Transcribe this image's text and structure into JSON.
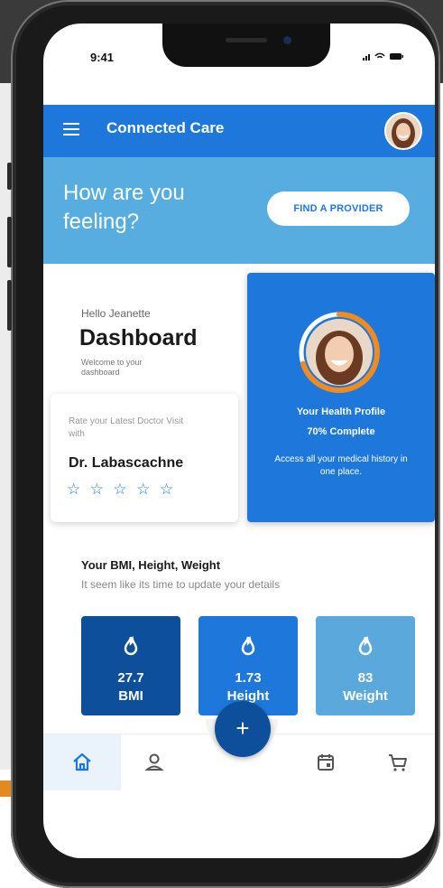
{
  "status_bar": {
    "time": "9:41",
    "icons": "▮▮▮ ◔ ▬"
  },
  "app_bar": {
    "title": "Connected Care"
  },
  "feeling": {
    "heading": "How are you feeling?",
    "button": "FIND A PROVIDER"
  },
  "dashboard": {
    "greeting": "Hello Jeanette",
    "title": "Dashboard",
    "welcome": "Welcome to your dashboard"
  },
  "rate": {
    "prompt": "Rate your Latest Doctor Visit with",
    "doctor": "Dr. Labascachne",
    "stars": [
      "☆",
      "☆",
      "☆",
      "☆",
      "☆"
    ]
  },
  "profile": {
    "title": "Your Health Profile",
    "complete": "70% Complete",
    "progress": 0.7,
    "description": "Access all your medical history in one place."
  },
  "metrics": {
    "heading": "Your BMI, Height, Weight",
    "subheading": "It seem like its time to update your details",
    "items": [
      {
        "value": "27.7",
        "label": "BMI",
        "icon": "flame-icon"
      },
      {
        "value": "1.73",
        "label": "Height",
        "icon": "flame-icon"
      },
      {
        "value": "83",
        "label": "Weight",
        "icon": "flame-icon"
      }
    ]
  },
  "bottom_nav": {
    "items": [
      "home-icon",
      "user-icon",
      "calendar-icon",
      "cart-icon"
    ],
    "fab": "+"
  },
  "colors": {
    "primary": "#1e78dc",
    "light": "#58ade0",
    "dark": "#0d4f9a",
    "accent": "#f28a1e"
  }
}
